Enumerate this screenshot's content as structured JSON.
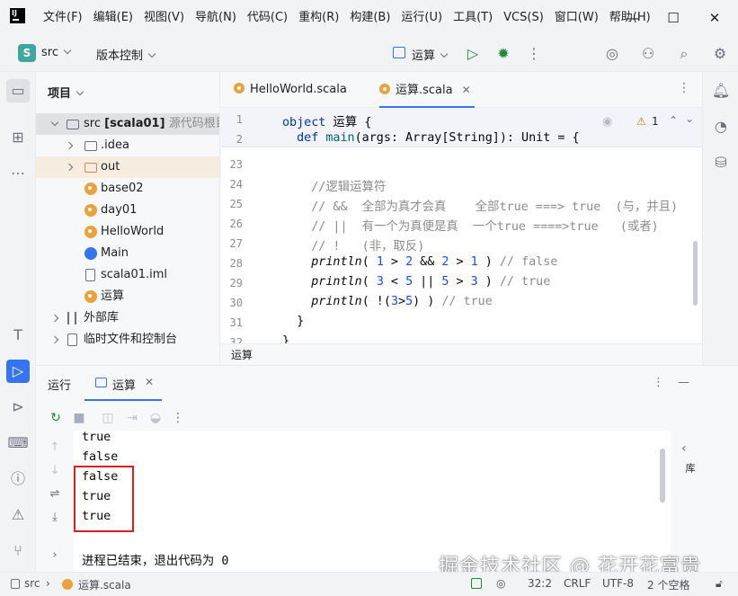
{
  "menu": [
    "文件(F)",
    "编辑(E)",
    "视图(V)",
    "导航(N)",
    "代码(C)",
    "重构(R)",
    "构建(B)",
    "运行(U)",
    "工具(T)",
    "VCS(S)",
    "窗口(W)",
    "帮助(H)"
  ],
  "toolbar": {
    "project_badge": "S",
    "project_name": "src",
    "vcs_label": "版本控制",
    "run_config": "运算"
  },
  "project_panel": {
    "title": "项目",
    "tree": [
      {
        "label": "src",
        "bold": "[scala01]",
        "hint": "源代码根目录"
      },
      {
        "label": ".idea"
      },
      {
        "label": "out"
      },
      {
        "label": "base02"
      },
      {
        "label": "day01"
      },
      {
        "label": "HelloWorld"
      },
      {
        "label": "Main"
      },
      {
        "label": "scala01.iml"
      },
      {
        "label": "运算"
      },
      {
        "label": "外部库"
      },
      {
        "label": "临时文件和控制台"
      }
    ]
  },
  "editor": {
    "tabs": [
      {
        "label": "HelloWorld.scala",
        "active": false
      },
      {
        "label": "运算.scala",
        "active": true
      }
    ],
    "warning_count": "1",
    "sticky_lines": [
      {
        "n": "1",
        "text": "object 运算 {"
      },
      {
        "n": "2",
        "text": "  def main(args: Array[String]): Unit = {"
      }
    ],
    "lines": [
      {
        "n": "23",
        "text": ""
      },
      {
        "n": "24",
        "text": "    //逻辑运算符"
      },
      {
        "n": "25",
        "text": "    // &&  全部为真才会真    全部true ===> true  (与，并且)"
      },
      {
        "n": "26",
        "text": "    // ||  有一个为真便是真  一个true ====>true   (或者)"
      },
      {
        "n": "27",
        "text": "    // !   (非，取反)"
      },
      {
        "n": "28",
        "text": "    println( 1 > 2 && 2 > 1 ) // false"
      },
      {
        "n": "29",
        "text": "    println( 3 < 5 || 5 > 3 ) // true"
      },
      {
        "n": "30",
        "text": "    println( !(3>5) ) // true"
      },
      {
        "n": "31",
        "text": "  }"
      },
      {
        "n": "32",
        "text": "}"
      }
    ],
    "breadcrumb": "运算"
  },
  "run_panel": {
    "title": "运行",
    "tab_label": "运算",
    "output": [
      "true",
      "false",
      "false",
      "true",
      "true"
    ],
    "exit_message": "进程已结束，退出代码为 0",
    "side_label": "库"
  },
  "status": {
    "path_root": "src",
    "path_file": "运算.scala",
    "position": "32:2",
    "line_sep": "CRLF",
    "encoding": "UTF-8",
    "indent": "2 个空格"
  },
  "watermark": "掘金技术社区 @ 花开花富贵",
  "colors": {
    "accent": "#3574f0",
    "highlight_box": "#e11d1d",
    "keyword": "#0033b3",
    "number": "#1750eb",
    "comment": "#8c8c8c"
  }
}
